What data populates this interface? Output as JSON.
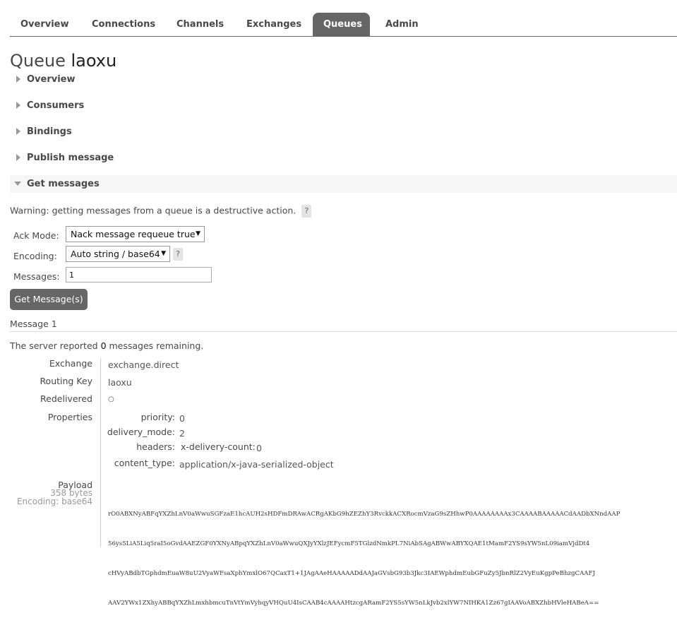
{
  "nav": {
    "tabs": [
      {
        "label": "Overview"
      },
      {
        "label": "Connections"
      },
      {
        "label": "Channels"
      },
      {
        "label": "Exchanges"
      },
      {
        "label": "Queues",
        "active": true
      },
      {
        "label": "Admin"
      }
    ]
  },
  "page": {
    "title_prefix": "Queue",
    "queue_name": "laoxu"
  },
  "sections": {
    "overview": "Overview",
    "consumers": "Consumers",
    "bindings": "Bindings",
    "publish": "Publish message",
    "get": "Get messages"
  },
  "get_messages": {
    "warning": "Warning: getting messages from a queue is a destructive action.",
    "help": "?",
    "ack_label": "Ack Mode:",
    "ack_value": "Nack message requeue true",
    "encoding_label": "Encoding:",
    "encoding_value": "Auto string / base64",
    "messages_label": "Messages:",
    "messages_value": "1",
    "button": "Get Message(s)"
  },
  "message": {
    "title": "Message 1",
    "reported_prefix": "The server reported",
    "remaining": "0",
    "reported_suffix": "messages remaining.",
    "exchange_label": "Exchange",
    "exchange": "exchange.direct",
    "routing_key_label": "Routing Key",
    "routing_key": "laoxu",
    "redelivered_label": "Redelivered",
    "redelivered": "○",
    "properties_label": "Properties",
    "properties": {
      "priority_label": "priority:",
      "priority": "0",
      "delivery_mode_label": "delivery_mode:",
      "delivery_mode": "2",
      "headers_label": "headers:",
      "x_delivery_count_label": "x-delivery-count:",
      "x_delivery_count": "0",
      "content_type_label": "content_type:",
      "content_type": "application/x-java-serialized-object"
    },
    "payload_label": "Payload",
    "payload_size": "358 bytes",
    "payload_encoding": "Encoding: base64",
    "payload_lines": [
      "rO0ABXNyABFqYXZhLnV0aWwuSGFzaE1hcAUH2sHDFmDRAwACRgAKbG9hZEZhY3RvckkACXRocmVzaG9sZHhwP0AAAAAAAAx3CAAAABAAAAACdAADbXNndAAP",
      "56ys5LiA5Liq5raI5oGvdAAEZGF0YXNyABpqYXZhLnV0aWwuQXJyYXlzJEFycmF5TGlzdNmkPL7NiAbSAgABWwABYXQAE1tMamF2YS9sYW5nL09iamVjdDt4",
      "cHVyABdbTGphdmEuaW8uU2VyaWFsaXphYmxlO67QCaxT1+1JAgAAeHAAAAADdAAJaGVsbG93b3Jkc3IAEWphdmEubGFuZy5JbnRlZ2VyEuKgpPeBhzgCAAFJ",
      "AAV2YWx1ZXhyABBqYXZhLmxhbmcuTnVtYmVyhqyVHQuU4IsCAAB4cAAAAHtzcgARamF2YS5sYW5nLkJvb2xlYW7NIHKA1Zz67gIAAVoABXZhbHVleHABeA=="
    ]
  }
}
